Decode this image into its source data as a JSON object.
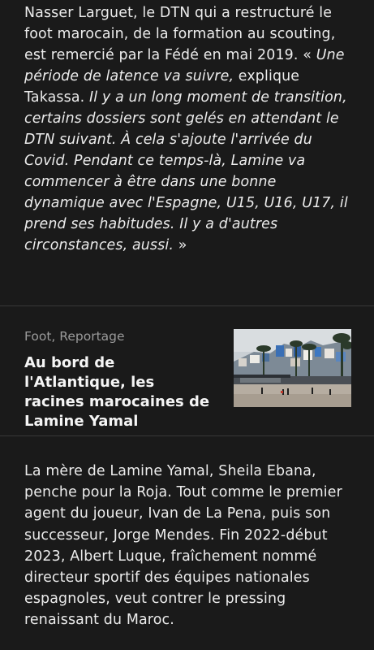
{
  "article": {
    "paragraph_1": {
      "text_plain": "Nasser Larguet, le DTN qui a restructuré le foot marocain, de la formation au scouting, est remercié par la Fédé en mai 2019. ",
      "quote_lead": "« ",
      "quote_italic_1": "Une période de latence va suivre,",
      "quote_attrib": " explique Takassa. ",
      "quote_italic_2": "Il y a un long moment de transition, certains dossiers sont gelés en attendant le DTN suivant. À cela s'ajoute l'arrivée du Covid. Pendant ce temps-là, Lamine va commencer à être dans une bonne dynamique avec l'Espagne, U15, U16, U17, il prend ses habitudes. Il y a d'autres circonstances, aussi.",
      "quote_close": " »"
    },
    "related": {
      "meta": "Foot, Reportage",
      "title": "Au bord de l'Atlantique, les racines marocaines de Lamine Yamal",
      "thumbnail_alt": "photo"
    },
    "paragraph_2": {
      "text": "La mère de Lamine Yamal, Sheila Ebana, penche pour la Roja. Tout comme le premier agent du joueur, Ivan de La Pena, puis son successeur, Jorge Mendes. Fin 2022-début 2023, Albert Luque, fraîchement nommé directeur sportif des équipes nationales espagnoles, veut contrer le pressing renaissant du Maroc."
    }
  },
  "colors": {
    "background": "#1a1a1a",
    "text": "#ececec",
    "meta": "#9b9b9b",
    "divider": "#383838"
  }
}
